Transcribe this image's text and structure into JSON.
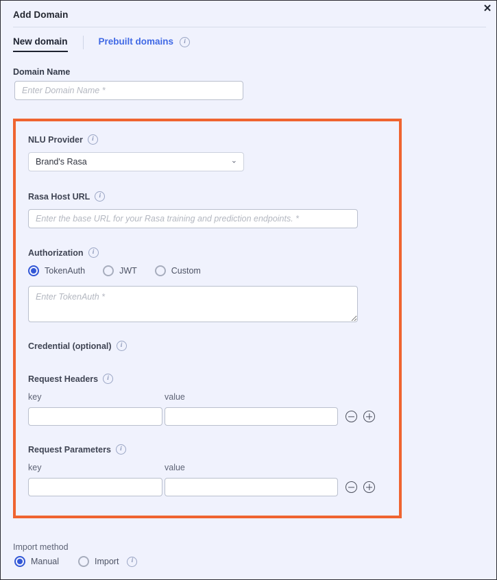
{
  "dialog": {
    "title": "Add Domain",
    "close_label": "✕"
  },
  "tabs": [
    {
      "label": "New domain",
      "active": true
    },
    {
      "label": "Prebuilt domains",
      "active": false,
      "info": "i"
    }
  ],
  "domain_name": {
    "label": "Domain Name",
    "placeholder": "Enter Domain Name *",
    "value": ""
  },
  "highlight": {
    "color": "#ef6430"
  },
  "nlu_provider": {
    "label": "NLU Provider",
    "info": "i",
    "selected": "Brand's Rasa",
    "options": [
      "Brand's Rasa"
    ],
    "chevron": "⌄"
  },
  "rasa_host_url": {
    "label": "Rasa Host URL",
    "info": "i",
    "placeholder": "Enter the base URL for your Rasa training and prediction endpoints. *",
    "value": ""
  },
  "authorization": {
    "label": "Authorization",
    "info": "i",
    "options": [
      {
        "label": "TokenAuth",
        "checked": true
      },
      {
        "label": "JWT",
        "checked": false
      },
      {
        "label": "Custom",
        "checked": false
      }
    ],
    "token_placeholder": "Enter TokenAuth *",
    "token_value": ""
  },
  "credential": {
    "label": "Credential (optional)",
    "info": "i"
  },
  "request_headers": {
    "label": "Request Headers",
    "info": "i",
    "key_header": "key",
    "value_header": "value",
    "rows": [
      {
        "key": "",
        "value": ""
      }
    ],
    "remove_icon": "minus-circle-icon",
    "add_icon": "plus-circle-icon"
  },
  "request_parameters": {
    "label": "Request Parameters",
    "info": "i",
    "key_header": "key",
    "value_header": "value",
    "rows": [
      {
        "key": "",
        "value": ""
      }
    ],
    "remove_icon": "minus-circle-icon",
    "add_icon": "plus-circle-icon"
  },
  "import_method": {
    "label": "Import method",
    "options": [
      {
        "label": "Manual",
        "checked": true
      },
      {
        "label": "Import",
        "checked": false,
        "info": "i"
      }
    ]
  },
  "colors": {
    "background": "#f0f2fd",
    "accent_blue": "#3257d6",
    "link_blue": "#4069e5",
    "highlight_orange": "#ef6430",
    "text_dark": "#22262f",
    "text_muted": "#5d6375"
  }
}
